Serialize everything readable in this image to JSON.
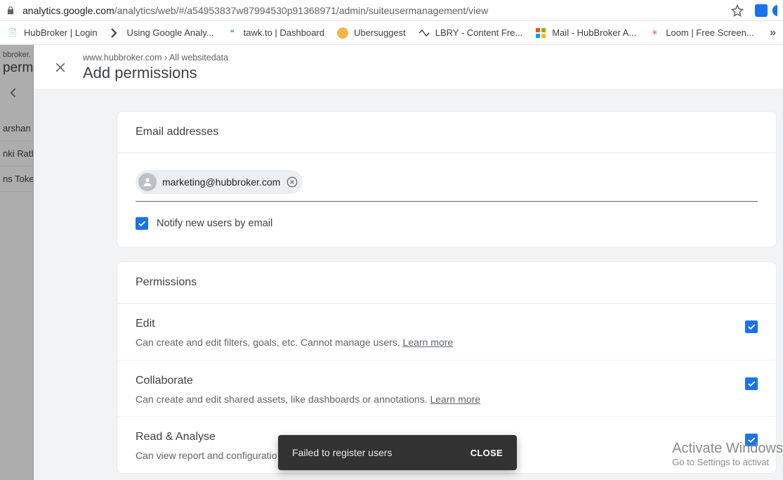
{
  "url": {
    "host": "analytics.google.com",
    "path": "/analytics/web/#/a54953837w87994530p91368971/admin/suiteusermanagement/view"
  },
  "bookmarks": [
    {
      "label": "HubBroker | Login"
    },
    {
      "label": "Using Google Analy..."
    },
    {
      "label": "tawk.to | Dashboard"
    },
    {
      "label": "Ubersuggest"
    },
    {
      "label": "LBRY - Content Fre..."
    },
    {
      "label": "Mail - HubBroker A..."
    },
    {
      "label": "Loom | Free Screen..."
    }
  ],
  "bgpage": {
    "hdr": "bbroker.",
    "title": "perm",
    "rows": [
      "arshan P",
      "nki Rath",
      "ns Toke"
    ]
  },
  "sheet": {
    "crumb": "www.hubbroker.com › All websitedata",
    "title": "Add permissions",
    "email_card": {
      "header": "Email addresses",
      "chip_email": "marketing@hubbroker.com",
      "notify_label": "Notify new users by email",
      "notify_checked": true
    },
    "perm_card": {
      "header": "Permissions",
      "items": [
        {
          "title": "Edit",
          "desc_a": "Can create and edit filters, goals, etc. Cannot manage users. ",
          "learn": "Learn more",
          "checked": true
        },
        {
          "title": "Collaborate",
          "desc_a": "Can create and edit shared assets, like dashboards or annotations. ",
          "learn": "Learn more",
          "checked": true
        },
        {
          "title": "Read & Analyse",
          "desc_a": "Can view report and configuratio",
          "learn": "",
          "checked": true
        }
      ]
    }
  },
  "toast": {
    "text": "Failed to register users",
    "action": "CLOSE"
  },
  "watermark": {
    "line1": "Activate Windows",
    "line2": "Go to Settings to activat"
  }
}
